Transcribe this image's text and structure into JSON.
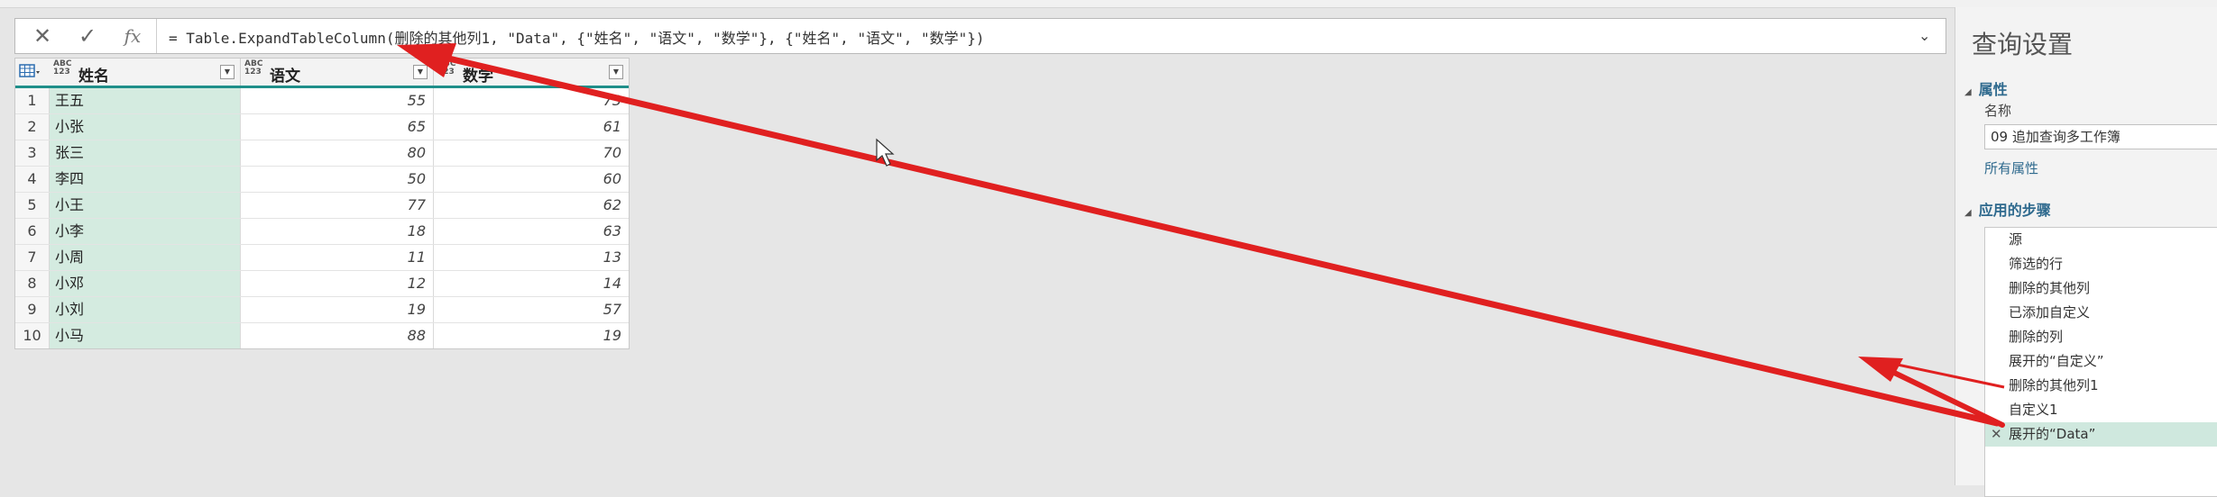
{
  "formula_bar": {
    "cancel_icon": "✕",
    "commit_icon": "✓",
    "fx_label": "fx",
    "formula": "= Table.ExpandTableColumn(删除的其他列1, \"Data\", {\"姓名\", \"语文\", \"数学\"}, {\"姓名\", \"语文\", \"数学\"})",
    "expand_icon": "⌄"
  },
  "grid": {
    "columns": [
      {
        "type": "ABC\n123",
        "name": "姓名"
      },
      {
        "type": "ABC\n123",
        "name": "语文"
      },
      {
        "type": "ABC\n123",
        "name": "数学"
      }
    ],
    "rows": [
      {
        "idx": "1",
        "name": "王五",
        "yuwen": "55",
        "shuxue": "73"
      },
      {
        "idx": "2",
        "name": "小张",
        "yuwen": "65",
        "shuxue": "61"
      },
      {
        "idx": "3",
        "name": "张三",
        "yuwen": "80",
        "shuxue": "70"
      },
      {
        "idx": "4",
        "name": "李四",
        "yuwen": "50",
        "shuxue": "60"
      },
      {
        "idx": "5",
        "name": "小王",
        "yuwen": "77",
        "shuxue": "62"
      },
      {
        "idx": "6",
        "name": "小李",
        "yuwen": "18",
        "shuxue": "63"
      },
      {
        "idx": "7",
        "name": "小周",
        "yuwen": "11",
        "shuxue": "13"
      },
      {
        "idx": "8",
        "name": "小邓",
        "yuwen": "12",
        "shuxue": "14"
      },
      {
        "idx": "9",
        "name": "小刘",
        "yuwen": "19",
        "shuxue": "57"
      },
      {
        "idx": "10",
        "name": "小马",
        "yuwen": "88",
        "shuxue": "19"
      }
    ]
  },
  "settings": {
    "title": "查询设置",
    "properties_header": "属性",
    "name_label": "名称",
    "name_value": "09 追加查询多工作簿",
    "all_properties": "所有属性",
    "steps_header": "应用的步骤",
    "steps": [
      "源",
      "筛选的行",
      "删除的其他列",
      "已添加自定义",
      "删除的列",
      "展开的“自定义”",
      "删除的其他列1",
      "自定义1",
      "展开的“Data”"
    ],
    "selected_step_index": 8
  },
  "colors": {
    "accent_teal": "#1f8f8a",
    "selected_column": "#d4ebe0",
    "annotation_arrow": "#e02020"
  }
}
